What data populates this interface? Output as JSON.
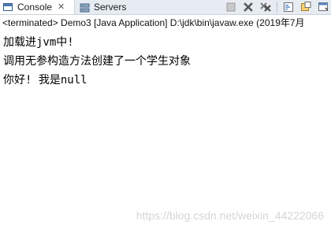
{
  "tabs": {
    "console": {
      "label": "Console",
      "close": "✕",
      "icon": "console-icon"
    },
    "servers": {
      "label": "Servers",
      "icon": "servers-icon"
    }
  },
  "toolbar": {
    "buttons": [
      "terminate-icon",
      "remove-launch-icon",
      "remove-all-icon",
      "scroll-lock-icon",
      "word-wrap-icon",
      "pin-console-icon"
    ]
  },
  "console": {
    "description": "<terminated> Demo3 [Java Application] D:\\jdk\\bin\\javaw.exe (2019年7月",
    "lines": [
      "加载进jvm中!",
      "调用无参构造方法创建了一个学生对象",
      "你好! 我是null"
    ]
  },
  "watermark": "https://blog.csdn.net/weixin_44222066"
}
